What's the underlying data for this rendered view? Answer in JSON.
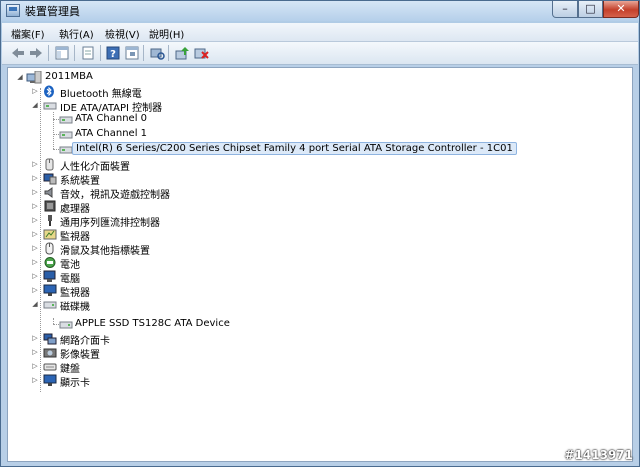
{
  "window": {
    "title": "裝置管理員",
    "controls": {
      "minimize": "–",
      "maximize": "□",
      "close": "✕"
    }
  },
  "menu": [
    "檔案(F)",
    "執行(A)",
    "檢視(V)",
    "說明(H)"
  ],
  "toolbar": [
    "back-icon",
    "forward-icon",
    "console-tree-icon",
    "properties-icon",
    "help-icon",
    "show-hidden-icon",
    "scan-hardware-icon",
    "update-driver-icon",
    "uninstall-icon"
  ],
  "tree": {
    "root": "2011MBA",
    "items": [
      {
        "label": "Bluetooth 無線電",
        "icon": "bluetooth-icon",
        "expanded": false
      },
      {
        "label": "IDE ATA/ATAPI 控制器",
        "icon": "ide-controller-icon",
        "expanded": true,
        "children": [
          "ATA Channel 0",
          "ATA Channel 1",
          "Intel(R) 6 Series/C200 Series Chipset Family 4 port Serial ATA Storage Controller - 1C01"
        ],
        "selected_child": 2
      },
      {
        "label": "人性化介面裝置",
        "icon": "hid-icon",
        "expanded": false
      },
      {
        "label": "系統裝置",
        "icon": "system-device-icon",
        "expanded": false
      },
      {
        "label": "音效，視訊及遊戲控制器",
        "icon": "sound-icon",
        "expanded": false
      },
      {
        "label": "處理器",
        "icon": "processor-icon",
        "expanded": false
      },
      {
        "label": "通用序列匯流排控制器",
        "icon": "usb-icon",
        "expanded": false
      },
      {
        "label": "監視器",
        "icon": "sensor-icon",
        "expanded": false
      },
      {
        "label": "滑鼠及其他指標裝置",
        "icon": "mouse-icon",
        "expanded": false
      },
      {
        "label": "電池",
        "icon": "battery-icon",
        "expanded": false
      },
      {
        "label": "電腦",
        "icon": "computer-icon",
        "expanded": false
      },
      {
        "label": "監視器",
        "icon": "monitor-icon",
        "expanded": false
      },
      {
        "label": "磁碟機",
        "icon": "disk-drive-icon",
        "expanded": true,
        "children": [
          "APPLE SSD TS128C ATA Device"
        ]
      },
      {
        "label": "網路介面卡",
        "icon": "network-adapter-icon",
        "expanded": false
      },
      {
        "label": "影像裝置",
        "icon": "imaging-icon",
        "expanded": false
      },
      {
        "label": "鍵盤",
        "icon": "keyboard-icon",
        "expanded": false
      },
      {
        "label": "顯示卡",
        "icon": "display-adapter-icon",
        "expanded": false
      }
    ]
  },
  "watermark": "#1413971",
  "colors": {
    "selection_bg": "#dce9f8",
    "selection_border": "#8fb4e0",
    "title_bg": "#c3d8ee"
  }
}
